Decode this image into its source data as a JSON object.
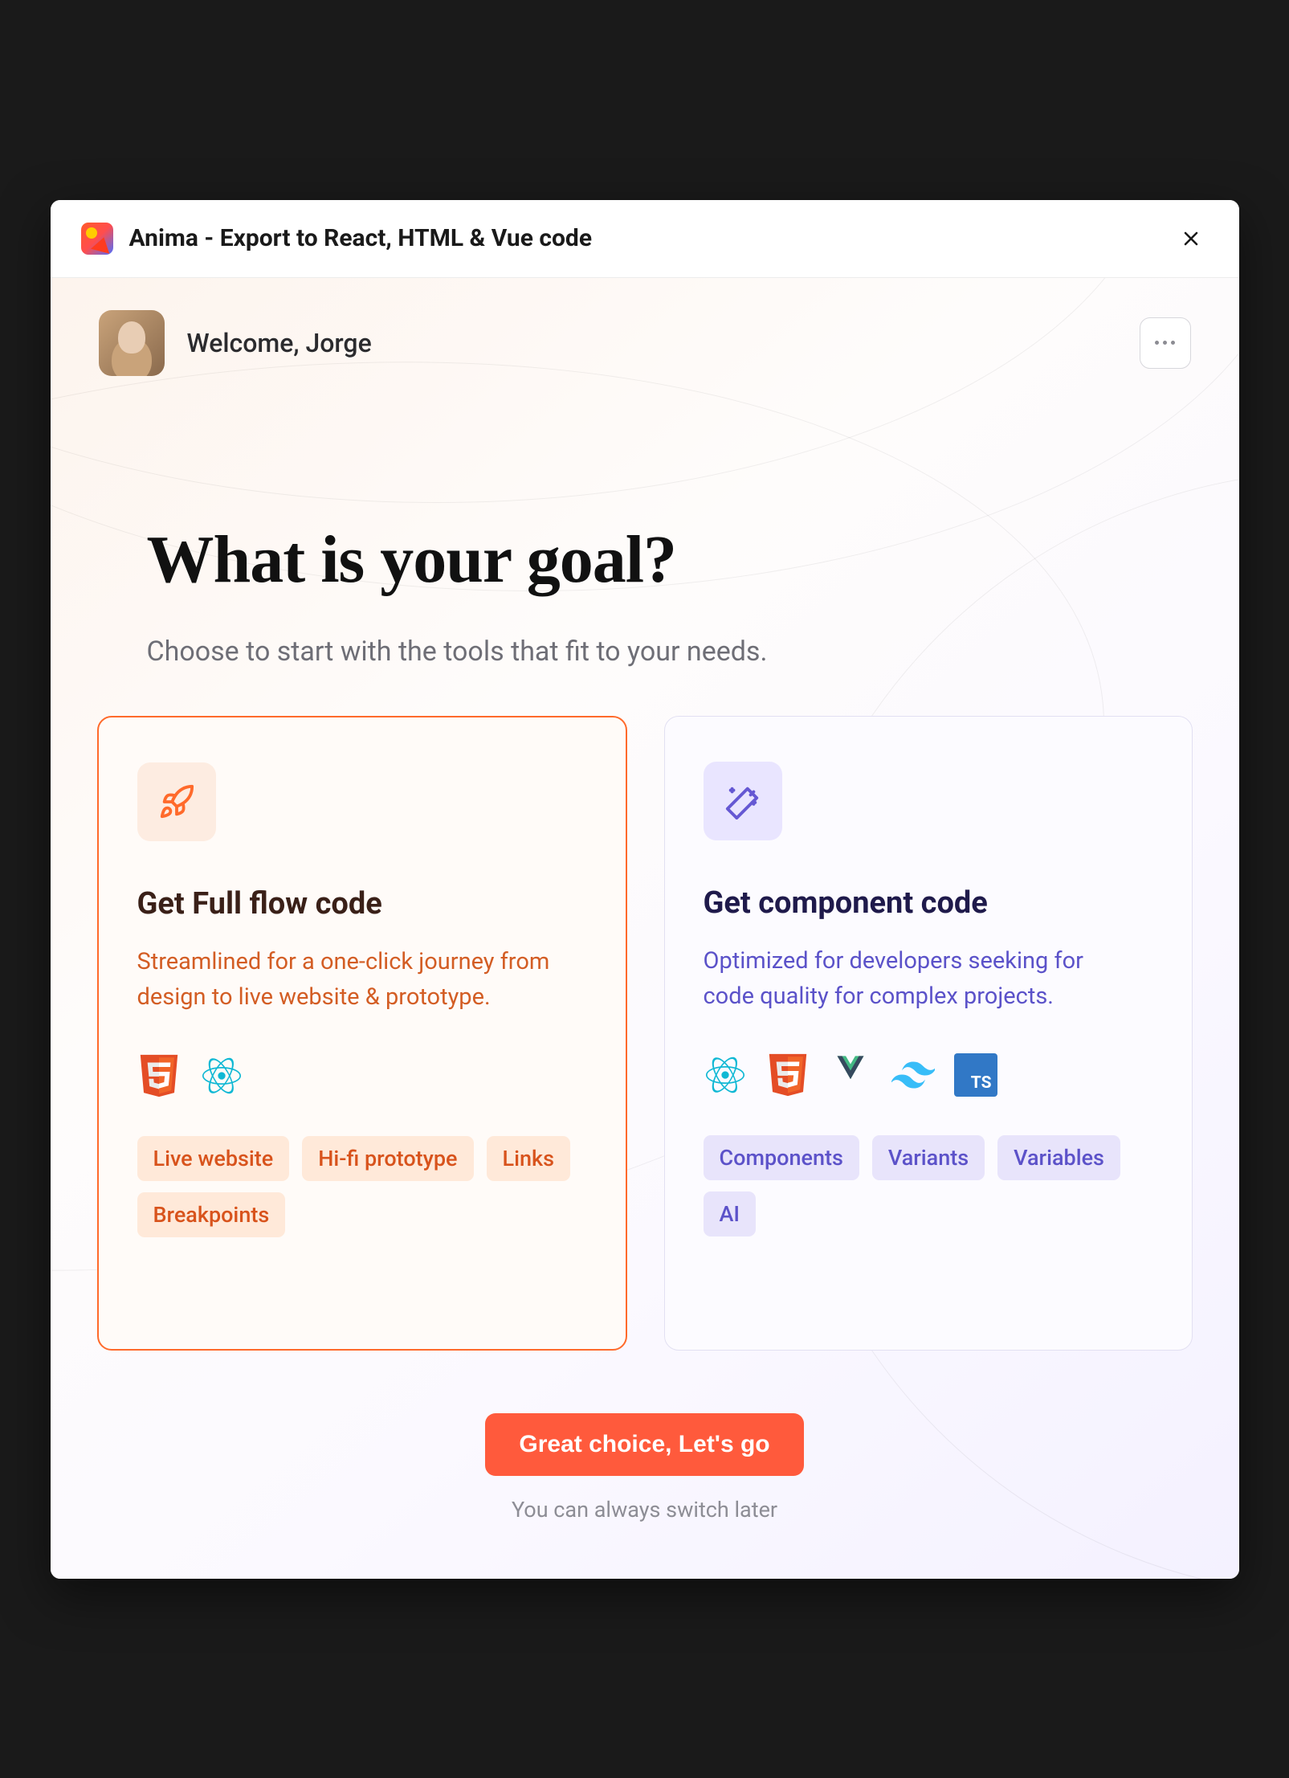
{
  "titlebar": {
    "title": "Anima - Export to React, HTML & Vue code"
  },
  "header": {
    "welcome": "Welcome, Jorge"
  },
  "hero": {
    "title": "What is your goal?",
    "subtitle": "Choose to start with the tools that fit to your needs."
  },
  "cards": {
    "fullflow": {
      "title": "Get Full flow code",
      "desc": "Streamlined for a one-click journey from design to live website & prototype.",
      "pills": [
        "Live website",
        "Hi-fi prototype",
        "Links",
        "Breakpoints"
      ]
    },
    "component": {
      "title": "Get component code",
      "desc": "Optimized for developers seeking for code quality for complex projects.",
      "pills": [
        "Components",
        "Variants",
        "Variables",
        "AI"
      ]
    }
  },
  "footer": {
    "cta": "Great choice, Let's go",
    "note": "You can always switch later"
  }
}
